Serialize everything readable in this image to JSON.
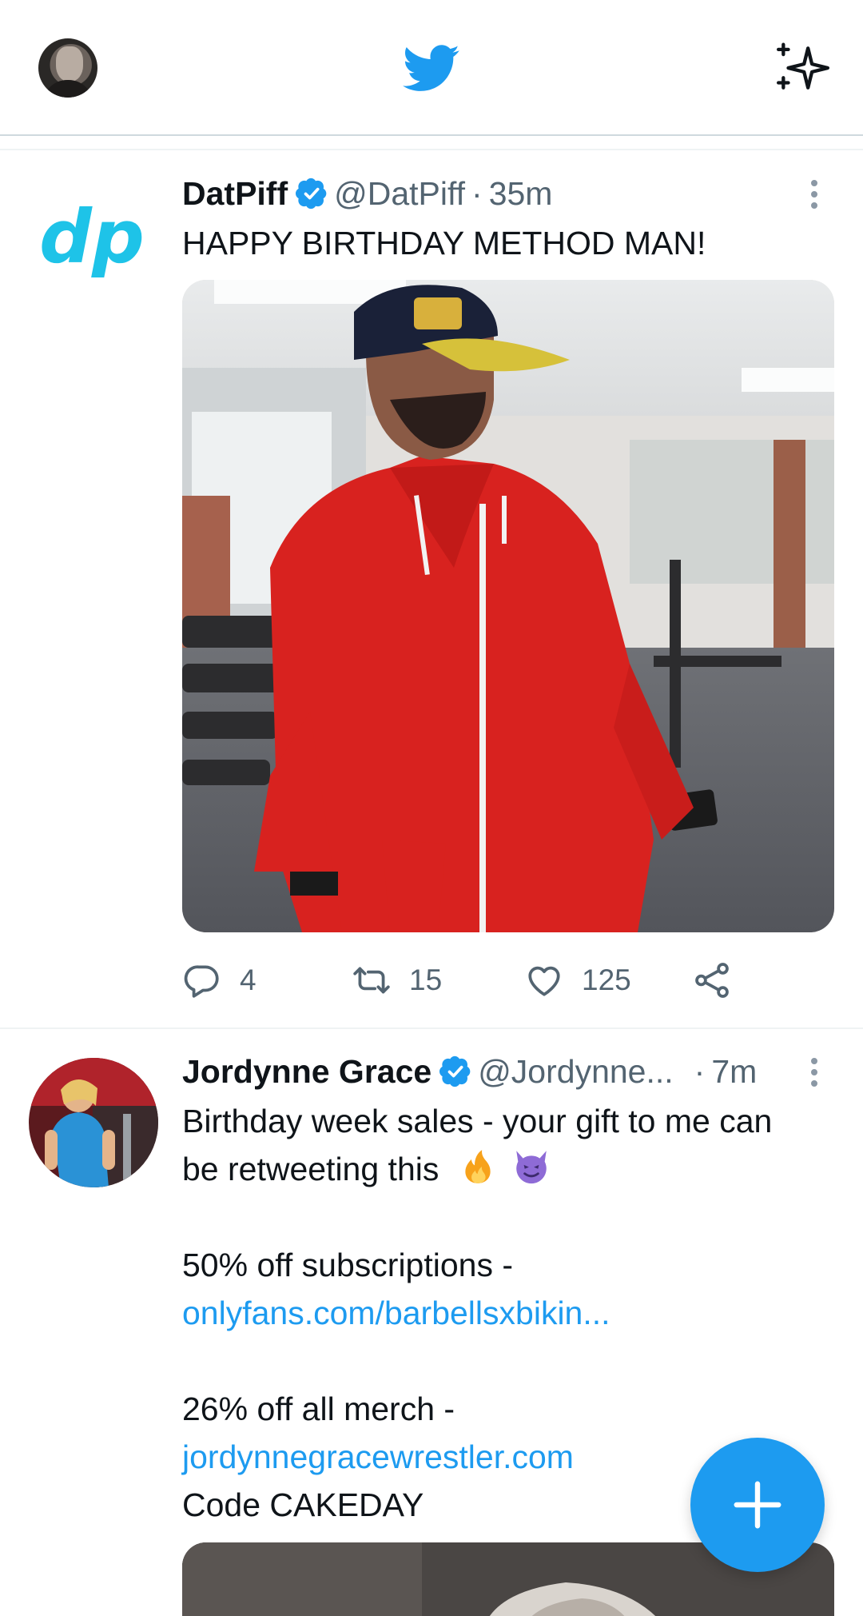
{
  "colors": {
    "brand": "#1d9bf0",
    "text_primary": "#0f1419",
    "text_secondary": "#536471",
    "divider": "#eff3f4"
  },
  "topbar": {
    "profile_icon": "user-avatar",
    "logo_icon": "twitter-bird-icon",
    "sparkle_icon": "sparkle-icon"
  },
  "tweets": [
    {
      "name": "DatPiff",
      "verified": true,
      "handle": "@DatPiff",
      "separator": "·",
      "time": "35m",
      "text": "HAPPY BIRTHDAY METHOD MAN!",
      "avatar_text": "dp",
      "actions": {
        "replies": "4",
        "retweets": "15",
        "likes": "125"
      }
    },
    {
      "name": "Jordynne Grace",
      "verified": true,
      "handle": "@Jordynne...",
      "separator": "·",
      "time": "7m",
      "line1": "Birthday week sales - your gift to me can",
      "line2": "be retweeting this",
      "line3": "50% off subscriptions -",
      "link1": "onlyfans.com/barbellsxbikin...",
      "line4": "26% off all merch -",
      "link2": "jordynnegracewrestler.com",
      "line5": "Code CAKEDAY"
    }
  ],
  "fab": {
    "icon": "plus-icon"
  }
}
